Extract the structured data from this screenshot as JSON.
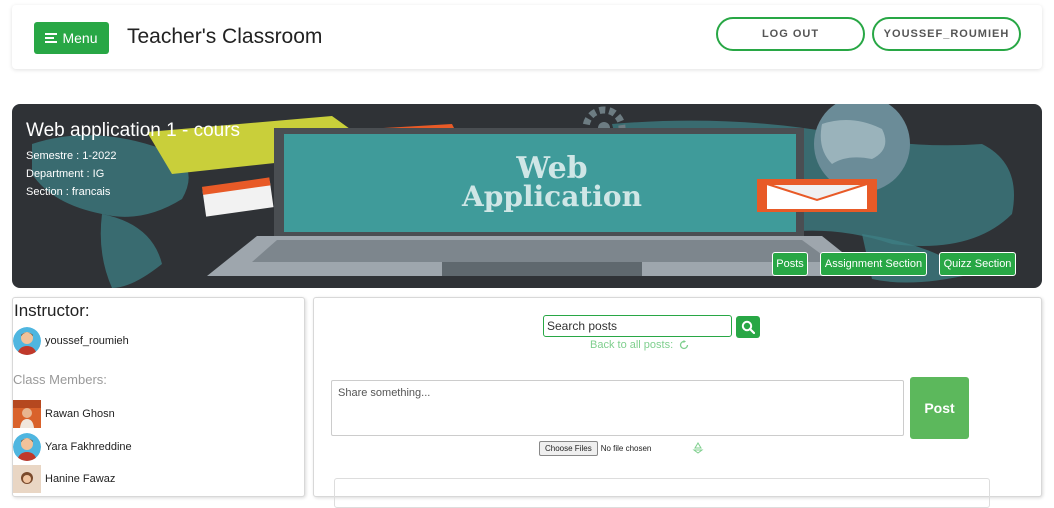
{
  "header": {
    "menu_label": "Menu",
    "app_title": "Teacher's Classroom",
    "logout_label": "LOG OUT",
    "user_label": "YOUSSEF_ROUMIEH"
  },
  "banner": {
    "title": "Web application 1 - cours",
    "semester": "Semestre : 1-2022",
    "department": "Department : IG",
    "section": "Section : francais",
    "image_text_line1": "Web",
    "image_text_line2": "Application",
    "buttons": {
      "posts": "Posts",
      "assignment": "Assignment Section",
      "quizz": "Quizz Section"
    }
  },
  "sidebar": {
    "instructor_label": "Instructor:",
    "instructor_name": "youssef_roumieh",
    "members_label": "Class Members:",
    "members": [
      "Rawan Ghosn",
      "Yara Fakhreddine",
      "Hanine Fawaz"
    ]
  },
  "feed": {
    "search_placeholder": "Search posts",
    "back_label": "Back to all posts:",
    "share_placeholder": "Share something...",
    "post_label": "Post",
    "choose_files_label": "Choose Files",
    "no_file_label": "No file chosen"
  },
  "colors": {
    "accent": "#28a745",
    "banner_bg": "#2f3236"
  },
  "icons": {
    "menu": "menu-bars-icon",
    "search": "search-icon",
    "refresh": "refresh-icon",
    "recycle": "recycle-icon"
  }
}
